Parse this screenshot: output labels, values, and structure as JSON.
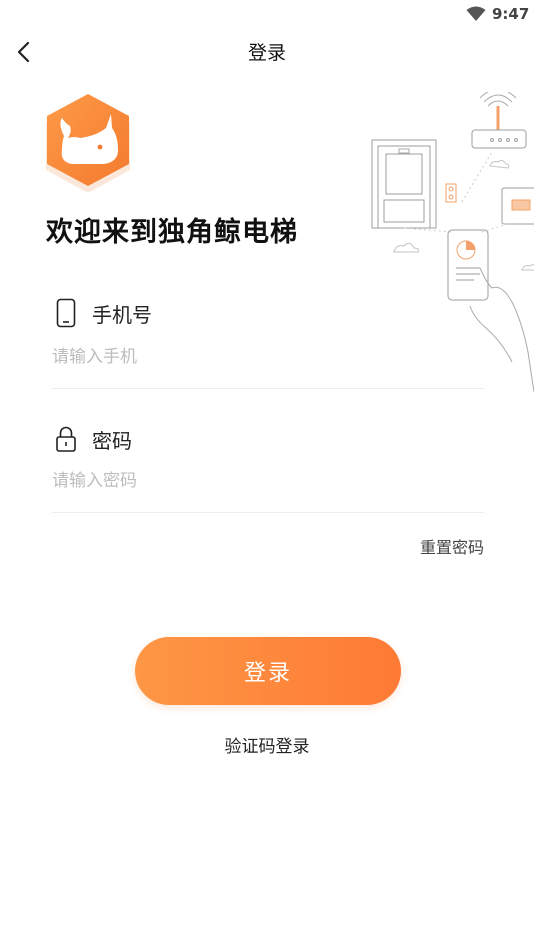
{
  "status_bar": {
    "time": "9:47",
    "wifi_icon": "wifi-icon"
  },
  "nav": {
    "title": "登录",
    "back_icon": "back-chevron-icon"
  },
  "welcome": "欢迎来到独角鲸电梯",
  "phone": {
    "label": "手机号",
    "placeholder": "请输入手机",
    "value": "",
    "icon": "phone-icon"
  },
  "password": {
    "label": "密码",
    "placeholder": "请输入密码",
    "value": "",
    "icon": "lock-icon"
  },
  "reset_password": "重置密码",
  "login_button": "登录",
  "sms_login": "验证码登录",
  "colors": {
    "accent": "#fe7a35",
    "accent_light": "#fd9745",
    "placeholder": "#bdbdbd"
  }
}
